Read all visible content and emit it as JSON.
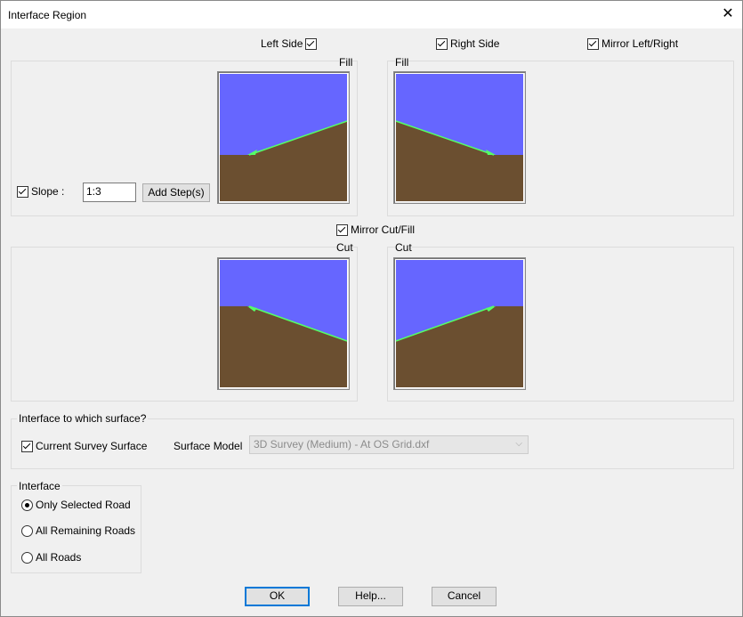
{
  "window": {
    "title": "Interface Region"
  },
  "icons": {
    "close": "✕"
  },
  "top_options": {
    "left_side": {
      "label": "Left Side",
      "checked": true
    },
    "right_side": {
      "label": "Right Side",
      "checked": true
    },
    "mirror_lr": {
      "label": "Mirror Left/Right",
      "checked": true
    }
  },
  "fill": {
    "left_title": "Fill",
    "right_title": "Fill",
    "slope_label": "Slope :",
    "slope_checked": true,
    "slope_value": "1:3",
    "add_step_label": "Add Step(s)"
  },
  "mirror_cut_fill": {
    "label": "Mirror Cut/Fill",
    "checked": true
  },
  "cut": {
    "left_title": "Cut",
    "right_title": "Cut"
  },
  "surface_group": {
    "title": "Interface to which surface?",
    "current_survey_label": "Current Survey Surface",
    "current_survey_checked": true,
    "surface_model_label": "Surface Model",
    "surface_model_value": "3D Survey (Medium) - At OS Grid.dxf"
  },
  "interface_group": {
    "title": "Interface",
    "options": [
      {
        "label": "Only Selected Road",
        "checked": true
      },
      {
        "label": "All Remaining Roads",
        "checked": false
      },
      {
        "label": "All Roads",
        "checked": false
      }
    ]
  },
  "buttons": {
    "ok": "OK",
    "help": "Help...",
    "cancel": "Cancel"
  },
  "colors": {
    "sky": "#6666ff",
    "ground": "#6b4f30",
    "slope_line": "#55ff66",
    "accent": "#0078d7"
  }
}
